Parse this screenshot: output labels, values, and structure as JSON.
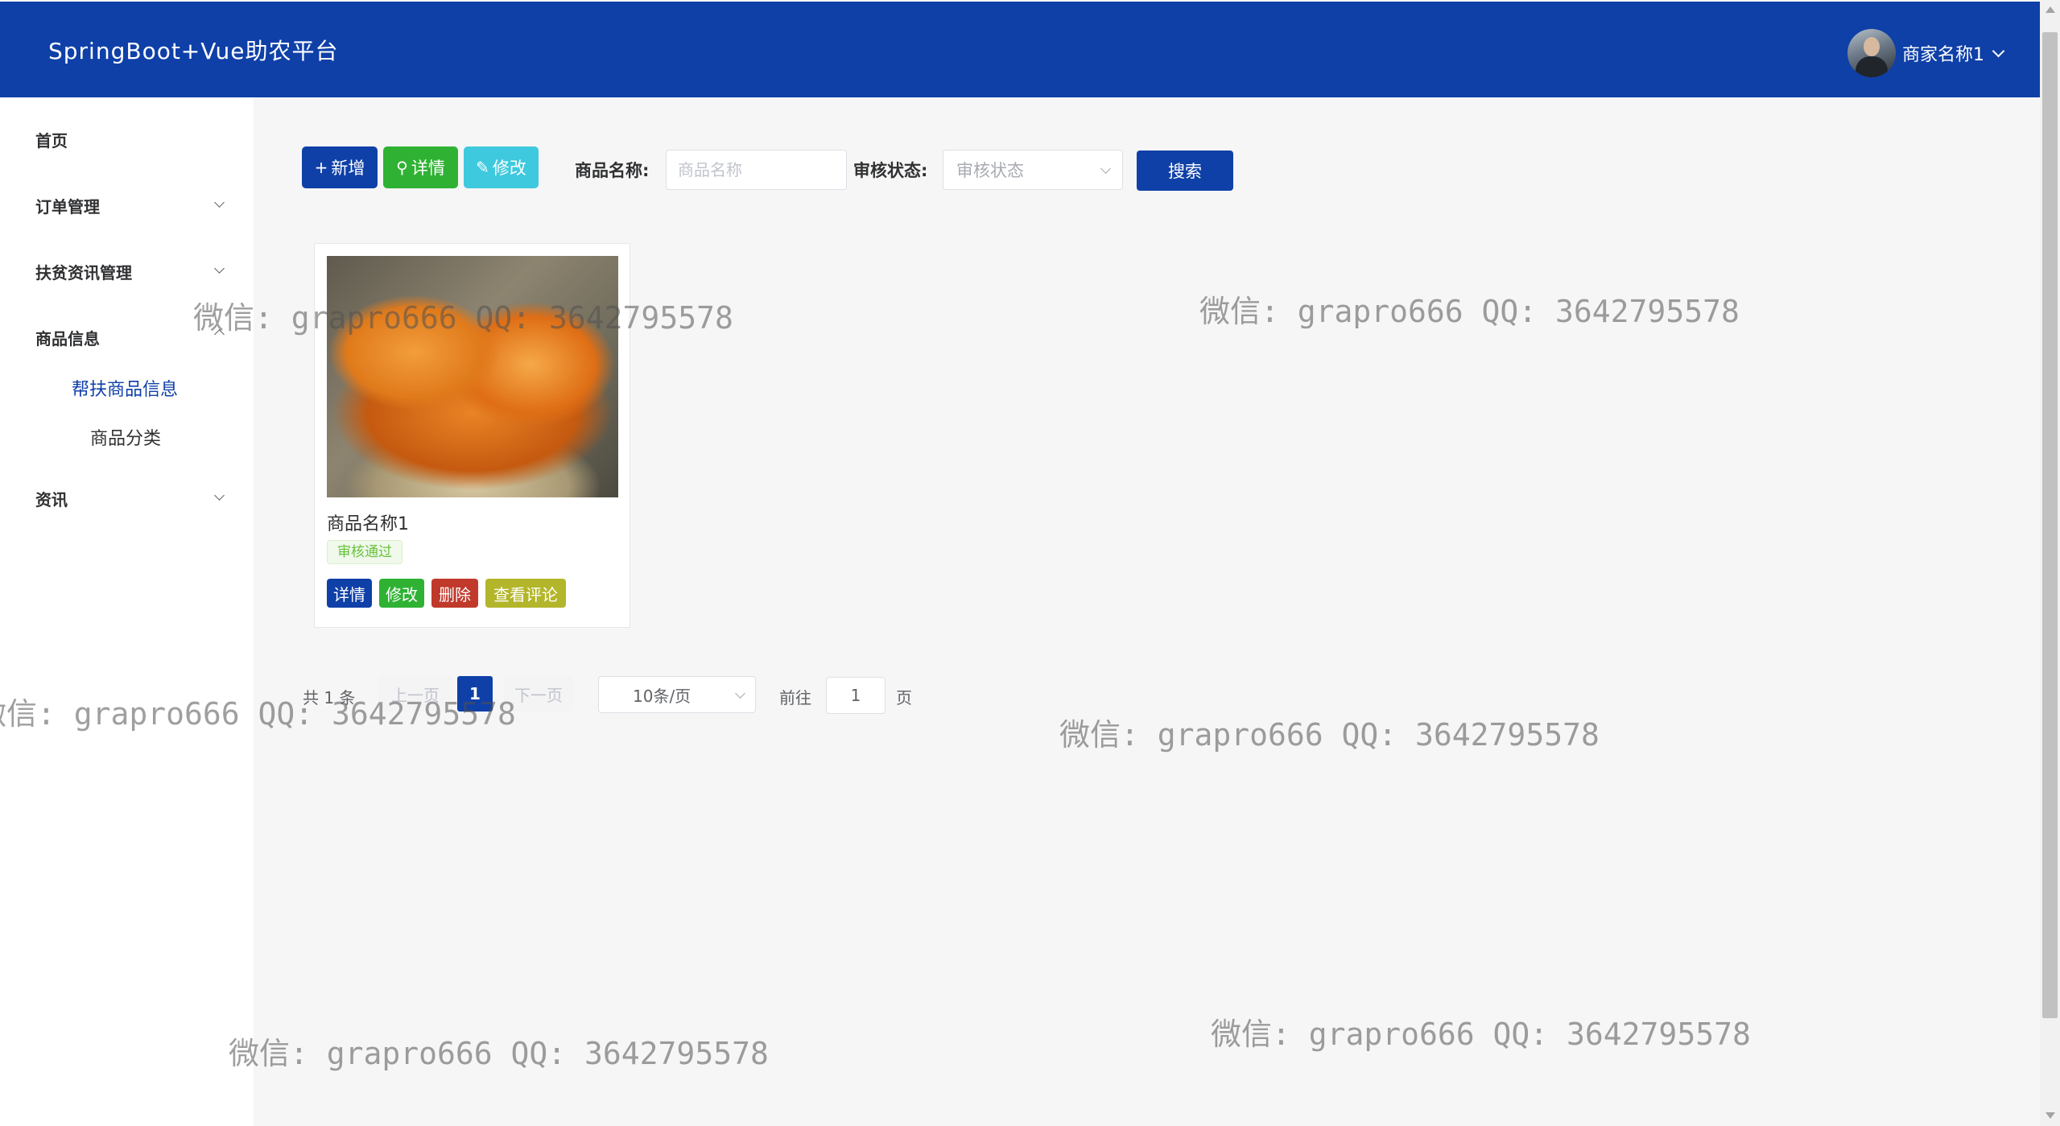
{
  "header": {
    "title": "SpringBoot+Vue助农平台",
    "user_name": "商家名称1"
  },
  "sidebar": {
    "items": [
      {
        "label": "首页"
      },
      {
        "label": "订单管理"
      },
      {
        "label": "扶贫资讯管理"
      },
      {
        "label": "商品信息",
        "children": [
          {
            "label": "帮扶商品信息"
          },
          {
            "label": "商品分类"
          }
        ]
      },
      {
        "label": "资讯"
      }
    ]
  },
  "toolbar": {
    "add_label": "新增",
    "detail_label": "详情",
    "edit_label": "修改",
    "name_label": "商品名称:",
    "name_placeholder": "商品名称",
    "status_label": "审核状态:",
    "status_placeholder": "审核状态",
    "search_label": "搜索"
  },
  "products": [
    {
      "name": "商品名称1",
      "status": "审核通过",
      "actions": {
        "detail": "详情",
        "edit": "修改",
        "delete": "删除",
        "comments": "查看评论"
      }
    }
  ],
  "pagination": {
    "total": "共 1 条",
    "prev": "上一页",
    "current": "1",
    "next": "下一页",
    "page_size": "10条/页",
    "goto_label": "前往",
    "goto_value": "1",
    "page_suffix": "页"
  },
  "watermark": "微信: grapro666 QQ: 3642795578",
  "colors": {
    "primary": "#0f40a8",
    "success": "#2fb233",
    "info": "#3ec9de",
    "danger": "#c0392b",
    "warning": "#b3b62a"
  }
}
